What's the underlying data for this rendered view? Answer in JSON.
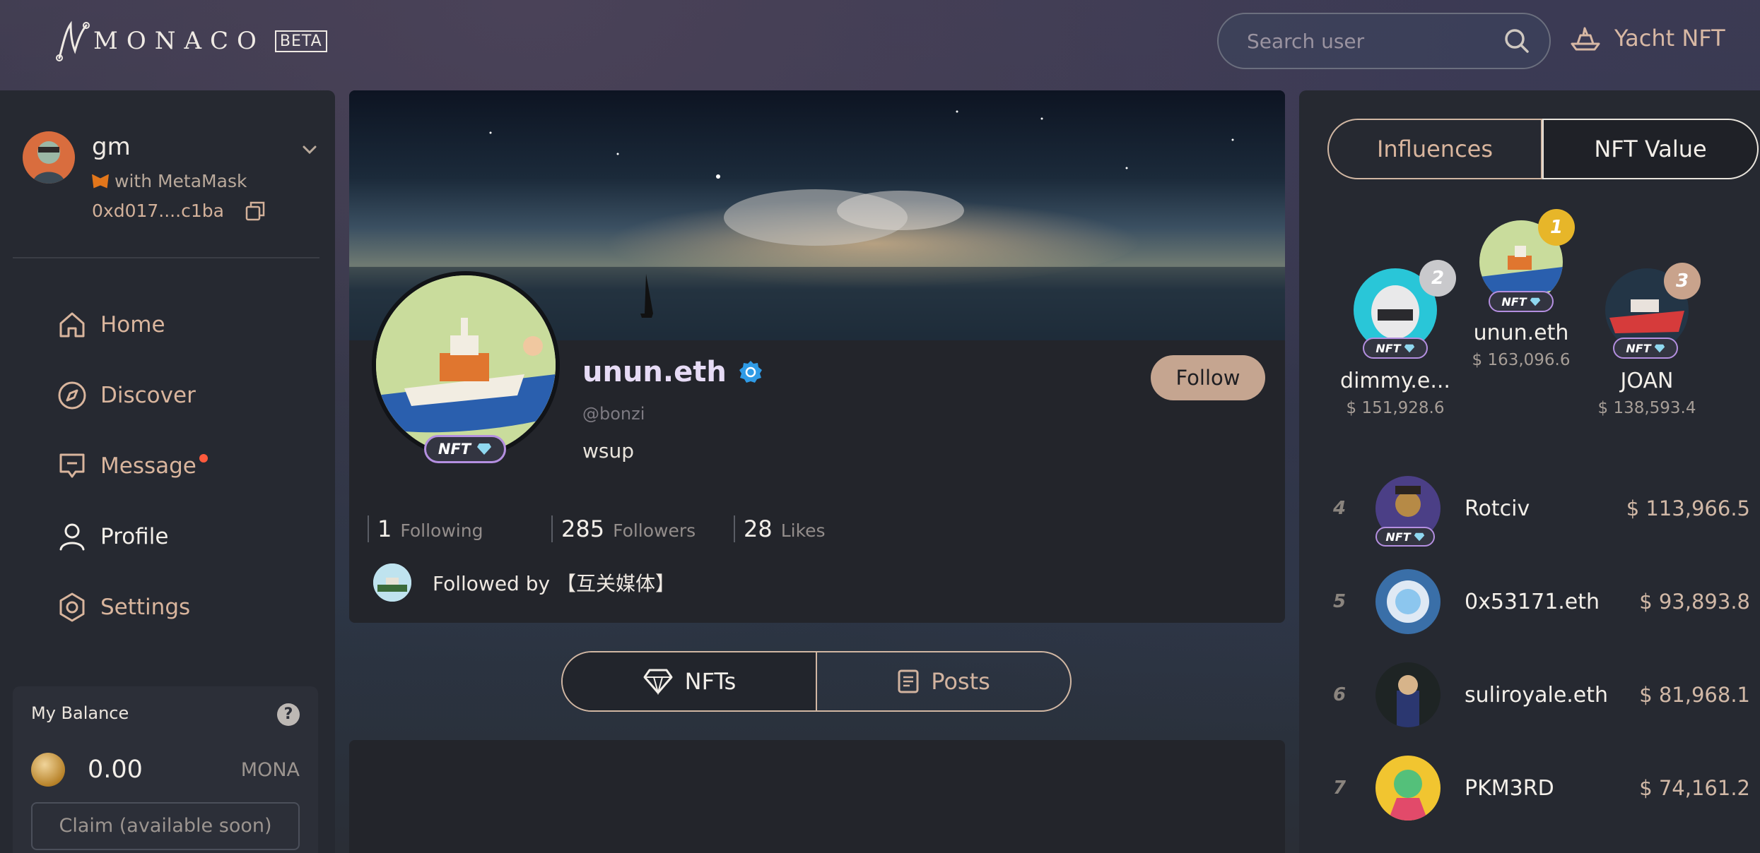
{
  "brand": {
    "name": "MONACO",
    "badge": "BETA"
  },
  "search": {
    "placeholder": "Search user"
  },
  "topnav": {
    "yacht_label": "Yacht NFT"
  },
  "account": {
    "name": "gm",
    "wallet": "with MetaMask",
    "address": "0xd017....c1ba"
  },
  "nav": {
    "home": "Home",
    "discover": "Discover",
    "message": "Message",
    "profile": "Profile",
    "settings": "Settings"
  },
  "balance": {
    "title": "My Balance",
    "help": "?",
    "amount": "0.00",
    "unit": "MONA",
    "claim": "Claim (available soon)"
  },
  "profile": {
    "username": "unun.eth",
    "handle": "@bonzi",
    "bio": "wsup",
    "follow_label": "Follow",
    "nft_badge": "NFT",
    "stats": {
      "following_count": "1",
      "following_label": "Following",
      "followers_count": "285",
      "followers_label": "Followers",
      "likes_count": "28",
      "likes_label": "Likes"
    },
    "followed_by": "Followed by 【互关媒体】"
  },
  "main_tabs": {
    "nfts": "NFTs",
    "posts": "Posts"
  },
  "leaderboard": {
    "tabs": {
      "influences": "Influences",
      "nft_value": "NFT Value"
    },
    "nft_badge": "NFT",
    "podium": [
      {
        "rank": "2",
        "name": "dimmy.e...",
        "value": "$ 151,928.6"
      },
      {
        "rank": "1",
        "name": "unun.eth",
        "value": "$ 163,096.6"
      },
      {
        "rank": "3",
        "name": "JOAN",
        "value": "$ 138,593.4"
      }
    ],
    "rows": [
      {
        "rank": "4",
        "name": "Rotciv",
        "value": "$ 113,966.5"
      },
      {
        "rank": "5",
        "name": "0x53171.eth",
        "value": "$ 93,893.8"
      },
      {
        "rank": "6",
        "name": "suliroyale.eth",
        "value": "$ 81,968.1"
      },
      {
        "rank": "7",
        "name": "PKM3RD",
        "value": "$ 74,161.2"
      }
    ]
  },
  "colors": {
    "accent": "#d9b59d",
    "follow_bg": "#c5a590",
    "notify_dot": "#ff5a3d",
    "verified": "#2f9be6"
  }
}
